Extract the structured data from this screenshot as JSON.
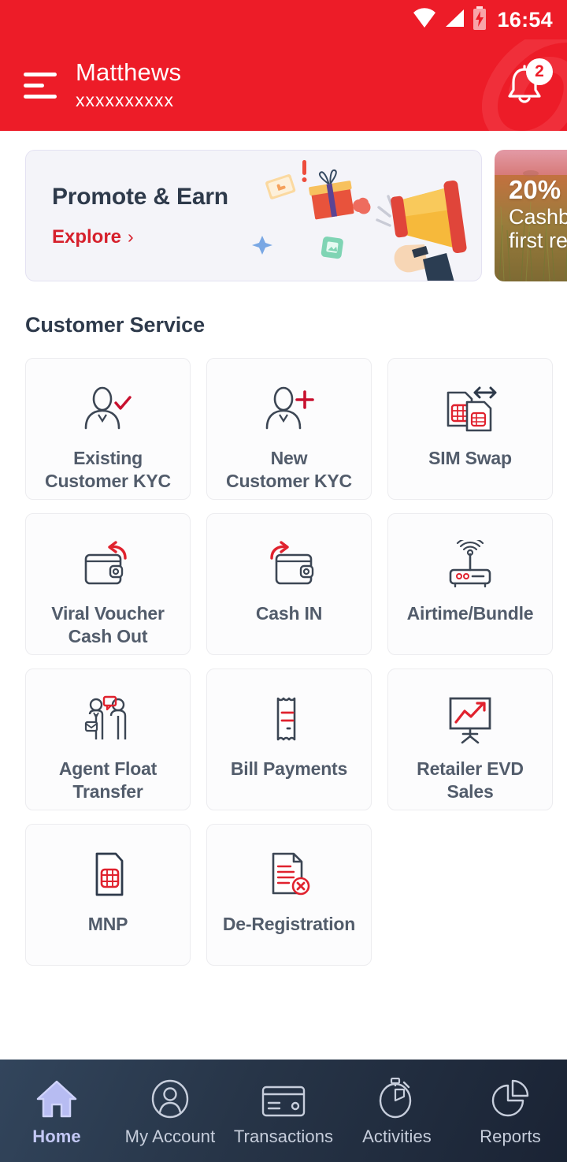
{
  "statusbar": {
    "time": "16:54",
    "icons": [
      "wifi-icon",
      "signal-icon",
      "battery-charging-icon"
    ]
  },
  "header": {
    "menu_icon": "hamburger-menu-icon",
    "user_name": "Matthews",
    "user_msisdn": "xxxxxxxxxx",
    "notification_icon": "bell-icon",
    "notification_count": "2",
    "background_color": "#ED1C28"
  },
  "banners": [
    {
      "id": "promote-earn",
      "title": "Promote & Earn",
      "link_label": "Explore",
      "link_chevron": "›",
      "background_color": "#F4F4F9",
      "link_color": "#D6202C",
      "art": "megaphone-gift-illustration"
    },
    {
      "id": "cashback",
      "percent": "20%",
      "line2": "Cashb",
      "line3": "first re",
      "art": "grass-field-photo"
    }
  ],
  "section": {
    "title": "Customer Service"
  },
  "tiles": [
    {
      "label": "Existing\nCustomer KYC",
      "icon": "person-check-icon"
    },
    {
      "label": "New\nCustomer KYC",
      "icon": "person-plus-icon"
    },
    {
      "label": "SIM Swap",
      "icon": "sim-swap-icon"
    },
    {
      "label": "Viral Voucher\nCash Out",
      "icon": "wallet-arrow-out-icon"
    },
    {
      "label": "Cash IN",
      "icon": "wallet-arrow-in-icon"
    },
    {
      "label": "Airtime/Bundle",
      "icon": "wifi-router-icon"
    },
    {
      "label": "Agent Float\nTransfer",
      "icon": "two-people-chat-icon"
    },
    {
      "label": "Bill Payments",
      "icon": "receipt-icon"
    },
    {
      "label": "Retailer EVD\nSales",
      "icon": "presentation-chart-icon"
    },
    {
      "label": "MNP",
      "icon": "sim-card-icon"
    },
    {
      "label": "De-Registration",
      "icon": "document-cancel-icon"
    }
  ],
  "bottomnav": {
    "items": [
      {
        "label": "Home",
        "icon": "home-icon",
        "active": true
      },
      {
        "label": "My Account",
        "icon": "user-circle-icon",
        "active": false
      },
      {
        "label": "Transactions",
        "icon": "credit-card-icon",
        "active": false
      },
      {
        "label": "Activities",
        "icon": "stopwatch-icon",
        "active": false
      },
      {
        "label": "Reports",
        "icon": "pie-chart-icon",
        "active": false
      }
    ],
    "active_color": "#C3C8F5"
  },
  "colors": {
    "brand_red": "#ED1C28",
    "link_red": "#D6202C",
    "icon_red": "#E0222E",
    "text_dark": "#2E3A4B",
    "tile_text": "#525C6B",
    "icon_slate": "#3C4654"
  }
}
